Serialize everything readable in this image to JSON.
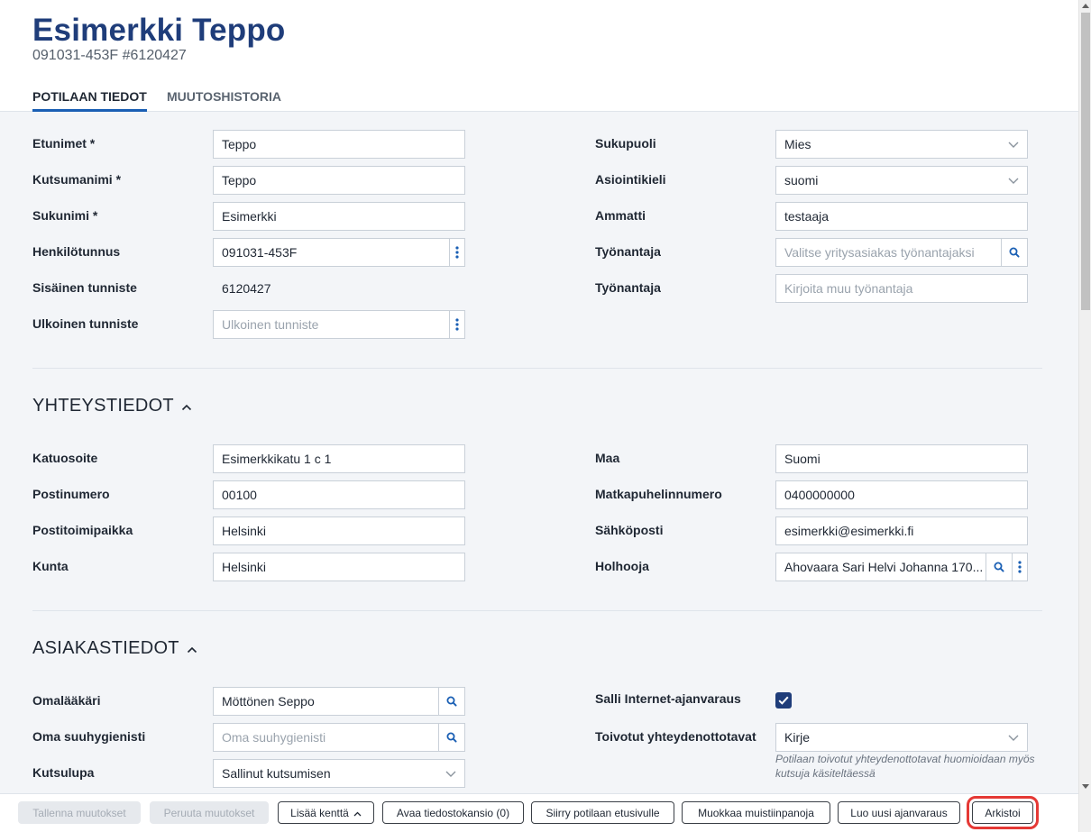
{
  "patient": {
    "name": "Esimerkki Teppo",
    "subtitle": "091031-453F #6120427"
  },
  "tabs": [
    "POTILAAN TIEDOT",
    "MUUTOSHISTORIA"
  ],
  "basic": {
    "etunimet": {
      "label": "Etunimet *",
      "value": "Teppo"
    },
    "kutsumanimi": {
      "label": "Kutsumanimi *",
      "value": "Teppo"
    },
    "sukunimi": {
      "label": "Sukunimi *",
      "value": "Esimerkki"
    },
    "henkilotunnus": {
      "label": "Henkilötunnus",
      "value": "091031-453F"
    },
    "sisainen": {
      "label": "Sisäinen tunniste",
      "value": "6120427"
    },
    "ulkoinen": {
      "label": "Ulkoinen tunniste",
      "placeholder": "Ulkoinen tunniste"
    },
    "sukupuoli": {
      "label": "Sukupuoli",
      "value": "Mies"
    },
    "asiointikieli": {
      "label": "Asiointikieli",
      "value": "suomi"
    },
    "ammatti": {
      "label": "Ammatti",
      "value": "testaaja"
    },
    "tyonantaja1": {
      "label": "Työnantaja",
      "placeholder": "Valitse yritysasiakas työnantajaksi"
    },
    "tyonantaja2": {
      "label": "Työnantaja",
      "placeholder": "Kirjoita muu työnantaja"
    }
  },
  "contact": {
    "title": "YHTEYSTIEDOT",
    "katuosoite": {
      "label": "Katuosoite",
      "value": "Esimerkkikatu 1 c 1"
    },
    "postinumero": {
      "label": "Postinumero",
      "value": "00100"
    },
    "postitoimipaikka": {
      "label": "Postitoimipaikka",
      "value": "Helsinki"
    },
    "kunta": {
      "label": "Kunta",
      "value": "Helsinki"
    },
    "maa": {
      "label": "Maa",
      "value": "Suomi"
    },
    "matkapuhelin": {
      "label": "Matkapuhelinnumero",
      "value": "0400000000"
    },
    "sahkoposti": {
      "label": "Sähköposti",
      "value": "esimerkki@esimerkki.fi"
    },
    "holhooja": {
      "label": "Holhooja",
      "value": "Ahovaara Sari Helvi Johanna 170..."
    }
  },
  "customer": {
    "title": "ASIAKASTIEDOT",
    "omalaakari": {
      "label": "Omalääkäri",
      "value": "Möttönen Seppo"
    },
    "suuhygienisti": {
      "label": "Oma suuhygienisti",
      "placeholder": "Oma suuhygienisti"
    },
    "kutsulupa": {
      "label": "Kutsulupa",
      "value": "Sallinut kutsumisen"
    },
    "internet": {
      "label": "Salli Internet-ajanvaraus",
      "checked": true
    },
    "yhteydenotto": {
      "label": "Toivotut yhteydenottotavat",
      "value": "Kirje",
      "hint": "Potilaan toivotut yhteydenottotavat huomioidaan myös kutsuja käsiteltäessä"
    }
  },
  "footer": {
    "save": "Tallenna muutokset",
    "cancel": "Peruuta muutokset",
    "add_field": "Lisää kenttä",
    "open_folder": "Avaa tiedostokansio (0)",
    "go_home": "Siirry potilaan etusivulle",
    "edit_notes": "Muokkaa muistiinpanoja",
    "new_booking": "Luo uusi ajanvaraus",
    "archive": "Arkistoi"
  },
  "colors": {
    "title": "#1f3d7a",
    "accent": "#1a5fb4",
    "highlight": "#e53935"
  }
}
